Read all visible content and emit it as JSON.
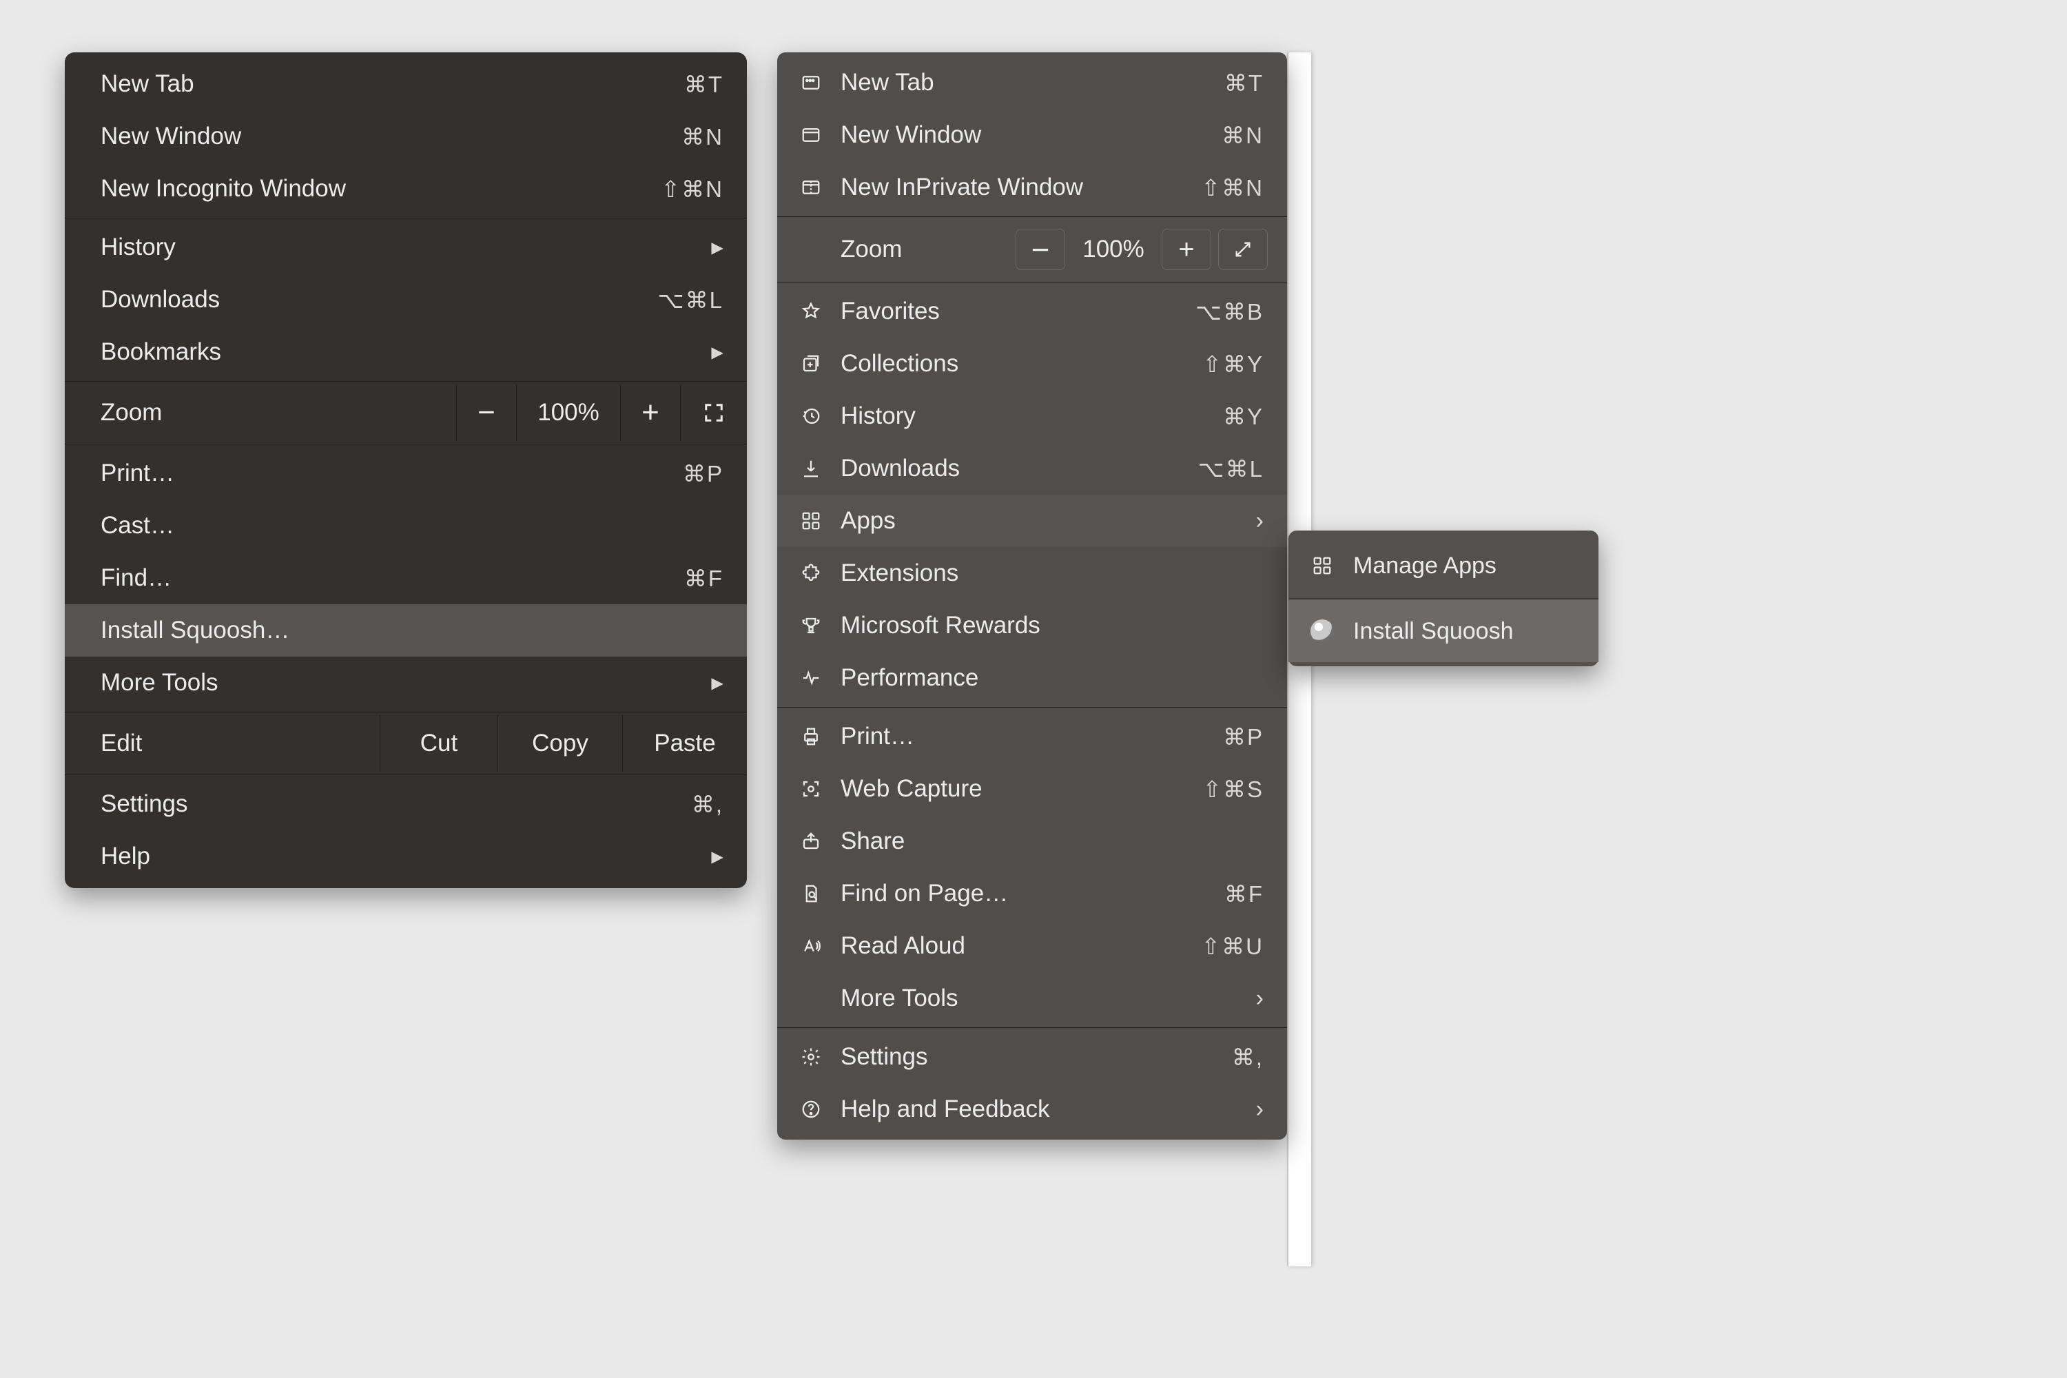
{
  "chrome": {
    "g1": {
      "newTab": {
        "label": "New Tab",
        "sc": "⌘T"
      },
      "newWindow": {
        "label": "New Window",
        "sc": "⌘N"
      },
      "newIncognito": {
        "label": "New Incognito Window",
        "sc": "⇧⌘N"
      }
    },
    "g2": {
      "history": {
        "label": "History"
      },
      "downloads": {
        "label": "Downloads",
        "sc": "⌥⌘L"
      },
      "bookmarks": {
        "label": "Bookmarks"
      }
    },
    "zoom": {
      "label": "Zoom",
      "value": "100%"
    },
    "g3": {
      "print": {
        "label": "Print…",
        "sc": "⌘P"
      },
      "cast": {
        "label": "Cast…"
      },
      "find": {
        "label": "Find…",
        "sc": "⌘F"
      },
      "install": {
        "label": "Install Squoosh…"
      },
      "more": {
        "label": "More Tools"
      }
    },
    "edit": {
      "label": "Edit",
      "cut": "Cut",
      "copy": "Copy",
      "paste": "Paste"
    },
    "g4": {
      "settings": {
        "label": "Settings",
        "sc": "⌘,"
      },
      "help": {
        "label": "Help"
      }
    }
  },
  "edge": {
    "g1": {
      "newTab": {
        "label": "New Tab",
        "sc": "⌘T"
      },
      "newWindow": {
        "label": "New Window",
        "sc": "⌘N"
      },
      "newInPrivate": {
        "label": "New InPrivate Window",
        "sc": "⇧⌘N"
      }
    },
    "zoom": {
      "label": "Zoom",
      "value": "100%"
    },
    "g2": {
      "favorites": {
        "label": "Favorites",
        "sc": "⌥⌘B"
      },
      "collections": {
        "label": "Collections",
        "sc": "⇧⌘Y"
      },
      "history": {
        "label": "History",
        "sc": "⌘Y"
      },
      "downloads": {
        "label": "Downloads",
        "sc": "⌥⌘L"
      },
      "apps": {
        "label": "Apps"
      },
      "extensions": {
        "label": "Extensions"
      },
      "rewards": {
        "label": "Microsoft Rewards"
      },
      "performance": {
        "label": "Performance"
      }
    },
    "g3": {
      "print": {
        "label": "Print…",
        "sc": "⌘P"
      },
      "capture": {
        "label": "Web Capture",
        "sc": "⇧⌘S"
      },
      "share": {
        "label": "Share"
      },
      "find": {
        "label": "Find on Page…",
        "sc": "⌘F"
      },
      "read": {
        "label": "Read Aloud",
        "sc": "⇧⌘U"
      },
      "more": {
        "label": "More Tools"
      }
    },
    "g4": {
      "settings": {
        "label": "Settings",
        "sc": "⌘,"
      },
      "help": {
        "label": "Help and Feedback"
      }
    },
    "sub": {
      "manage": {
        "label": "Manage Apps"
      },
      "install": {
        "label": "Install Squoosh"
      }
    }
  }
}
